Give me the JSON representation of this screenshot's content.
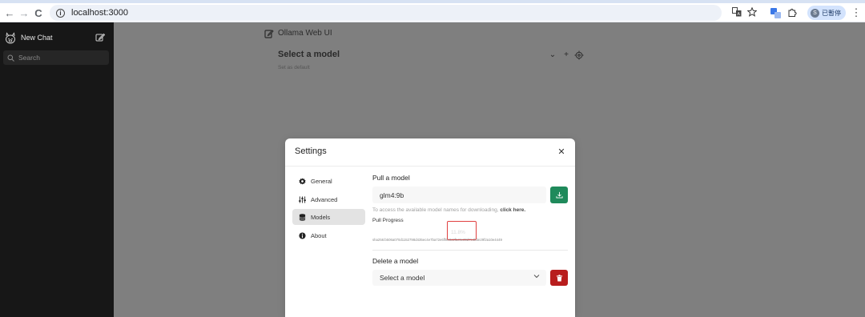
{
  "browser": {
    "url": "localhost:3000",
    "profile_label": "已暫停",
    "profile_initial": "S",
    "nav_back": "←",
    "nav_forward": "→",
    "nav_reload": "C",
    "menu_glyph": "⋮"
  },
  "sidebar": {
    "new_chat_label": "New Chat",
    "search_placeholder": "Search"
  },
  "main": {
    "header_title": "Ollama Web UI",
    "model_selector_title": "Select a model",
    "set_default_label": "Set as default",
    "controls": {
      "chevron": "⌄",
      "plus": "+"
    }
  },
  "settings": {
    "title": "Settings",
    "close_glyph": "✕",
    "tabs": [
      {
        "label": "General",
        "icon": "gear-icon"
      },
      {
        "label": "Advanced",
        "icon": "sliders-icon"
      },
      {
        "label": "Models",
        "icon": "database-icon",
        "active": true
      },
      {
        "label": "About",
        "icon": "info-icon"
      }
    ],
    "models": {
      "pull_title": "Pull a model",
      "pull_input_value": "glm4:9b",
      "hint_text": "To access the available model names for downloading, ",
      "hint_link": "click here.",
      "pull_progress_label": "Pull Progress",
      "pull_progress_percent": "11.8%",
      "digest": "sha256:b506a070d1152798d435ec4e7ba72e6ff8c8c2f1c9e39d7c4b3e29f2a10e4449",
      "delete_title": "Delete a model",
      "delete_select_value": "Select a model"
    }
  },
  "colors": {
    "download_button": "#1f8a5b",
    "delete_button": "#b81d1d",
    "highlight_box": "#e04040",
    "sidebar_bg": "#171717",
    "overlay_bg": "#7f7f7f"
  }
}
